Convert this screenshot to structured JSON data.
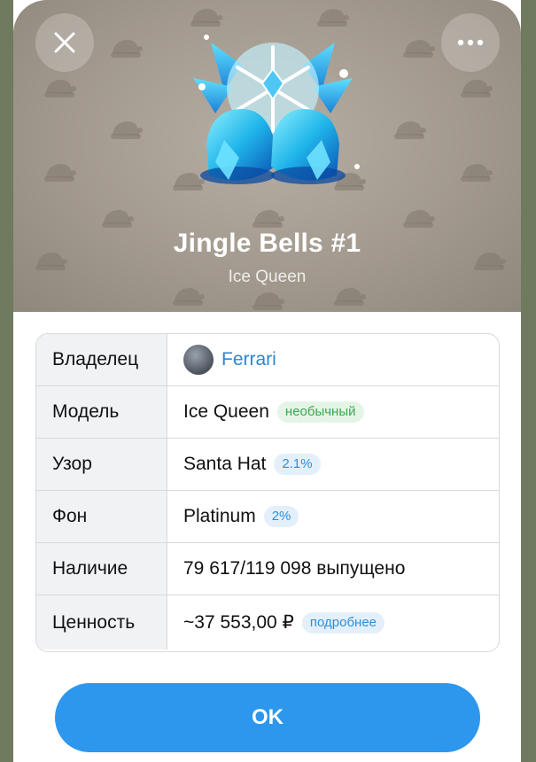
{
  "colors": {
    "accent": "#2d97ee",
    "link": "#2a86d6",
    "badge_green_text": "#3da74e",
    "badge_blue_text": "#2f8ed8",
    "hero_bg": "#a39a8f"
  },
  "hero": {
    "close_icon": "close-icon",
    "more_icon": "more-horizontal-icon",
    "gift_icon": "jingle-bells-ice-icon",
    "title": "Jingle Bells #1",
    "subtitle": "Ice Queen"
  },
  "details": {
    "rows": [
      {
        "label": "Владелец",
        "value": "Ferrari"
      },
      {
        "label": "Модель",
        "value": "Ice Queen",
        "badge": "необычный"
      },
      {
        "label": "Узор",
        "value": "Santa Hat",
        "badge": "2.1%"
      },
      {
        "label": "Фон",
        "value": "Platinum",
        "badge": "2%"
      },
      {
        "label": "Наличие",
        "value": "79 617/119 098 выпущено"
      },
      {
        "label": "Ценность",
        "value": "~37 553,00 ₽",
        "badge": "подробнее"
      }
    ]
  },
  "footer": {
    "ok_label": "OK"
  }
}
